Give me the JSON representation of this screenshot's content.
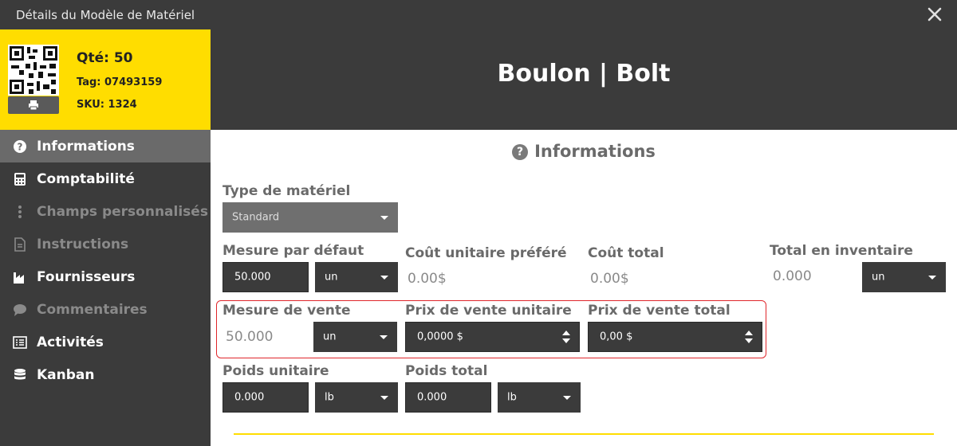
{
  "window": {
    "title": "Détails du Modèle de Matériel"
  },
  "item": {
    "qty": "Qté: 50",
    "tag": "Tag: 07493159",
    "sku": "SKU: 1324",
    "name": "Boulon | Bolt"
  },
  "sidebar": {
    "items": [
      {
        "label": "Informations",
        "icon": "question-circle-icon",
        "active": true,
        "enabled": true
      },
      {
        "label": "Comptabilité",
        "icon": "calculator-icon",
        "active": false,
        "enabled": true
      },
      {
        "label": "Champs personnalisés",
        "icon": "vertical-ellipsis-icon",
        "active": false,
        "enabled": false
      },
      {
        "label": "Instructions",
        "icon": "document-icon",
        "active": false,
        "enabled": false
      },
      {
        "label": "Fournisseurs",
        "icon": "factory-icon",
        "active": false,
        "enabled": true
      },
      {
        "label": "Commentaires",
        "icon": "comment-icon",
        "active": false,
        "enabled": false
      },
      {
        "label": "Activités",
        "icon": "list-icon",
        "active": false,
        "enabled": true
      },
      {
        "label": "Kanban",
        "icon": "database-icon",
        "active": false,
        "enabled": true
      }
    ]
  },
  "section": {
    "title": "Informations"
  },
  "form": {
    "material_type": {
      "label": "Type de matériel",
      "value": "Standard"
    },
    "default_measure": {
      "label": "Mesure par défaut",
      "value": "50.000",
      "unit": "un"
    },
    "preferred_unit_cost": {
      "label": "Coût unitaire préféré",
      "value": "0.00$"
    },
    "total_cost": {
      "label": "Coût total",
      "value": "0.00$"
    },
    "total_inventory": {
      "label": "Total en inventaire",
      "value": "0.000",
      "unit": "un"
    },
    "sale_measure": {
      "label": "Mesure de vente",
      "value": "50.000",
      "unit": "un"
    },
    "unit_sale_price": {
      "label": "Prix de vente unitaire",
      "value": "0,0000 $"
    },
    "total_sale_price": {
      "label": "Prix de vente total",
      "value": "0,00 $"
    },
    "unit_weight": {
      "label": "Poids unitaire",
      "value": "0.000",
      "unit": "lb"
    },
    "total_weight": {
      "label": "Poids total",
      "value": "0.000",
      "unit": "lb"
    }
  },
  "colors": {
    "accent": "#ffdd00",
    "dark": "#3b3b3b",
    "highlight": "#e0262b"
  }
}
